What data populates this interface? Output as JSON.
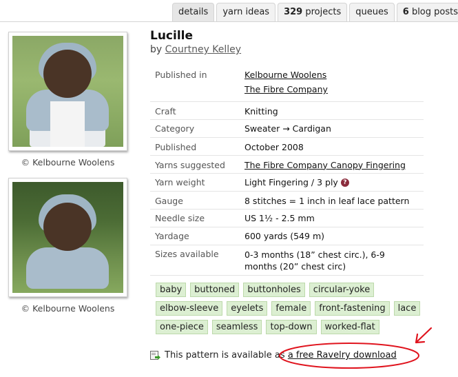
{
  "tabs": [
    {
      "label": "details",
      "count": ""
    },
    {
      "label": "yarn ideas",
      "count": ""
    },
    {
      "label": "projects",
      "count": "329"
    },
    {
      "label": "queues",
      "count": ""
    },
    {
      "label": "blog posts",
      "count": "6"
    }
  ],
  "pattern": {
    "title": "Lucille",
    "by_prefix": "by",
    "designer": "Courtney Kelley"
  },
  "photos": [
    {
      "caption": "© Kelbourne Woolens"
    },
    {
      "caption": "© Kelbourne Woolens"
    }
  ],
  "details": {
    "published_in_label": "Published in",
    "published_in": [
      "Kelbourne Woolens",
      "The Fibre Company"
    ],
    "craft_label": "Craft",
    "craft": "Knitting",
    "category_label": "Category",
    "category": "Sweater → Cardigan",
    "published_label": "Published",
    "published": "October 2008",
    "yarns_label": "Yarns suggested",
    "yarns": "The Fibre Company Canopy Fingering",
    "weight_label": "Yarn weight",
    "weight": "Light Fingering / 3 ply",
    "help_glyph": "?",
    "gauge_label": "Gauge",
    "gauge": "8 stitches = 1 inch in leaf lace pattern",
    "needle_label": "Needle size",
    "needle": "US 1½ - 2.5 mm",
    "yardage_label": "Yardage",
    "yardage": "600 yards (549 m)",
    "sizes_label": "Sizes available",
    "sizes_line1": "0-3 months (18” chest circ.), 6-9",
    "sizes_line2": "months (20” chest circ)"
  },
  "tags": [
    [
      "baby",
      "buttoned",
      "buttonholes",
      "circular-yoke"
    ],
    [
      "elbow-sleeve",
      "eyelets",
      "female",
      "front-fastening",
      "lace"
    ],
    [
      "one-piece",
      "seamless",
      "top-down",
      "worked-flat"
    ]
  ],
  "download": {
    "text": "This pattern is available as",
    "link": "a free Ravelry download"
  },
  "colors": {
    "tag_bg": "#dcefd2",
    "annotation_red": "#e0141e",
    "help_icon": "#8b2c3c"
  }
}
